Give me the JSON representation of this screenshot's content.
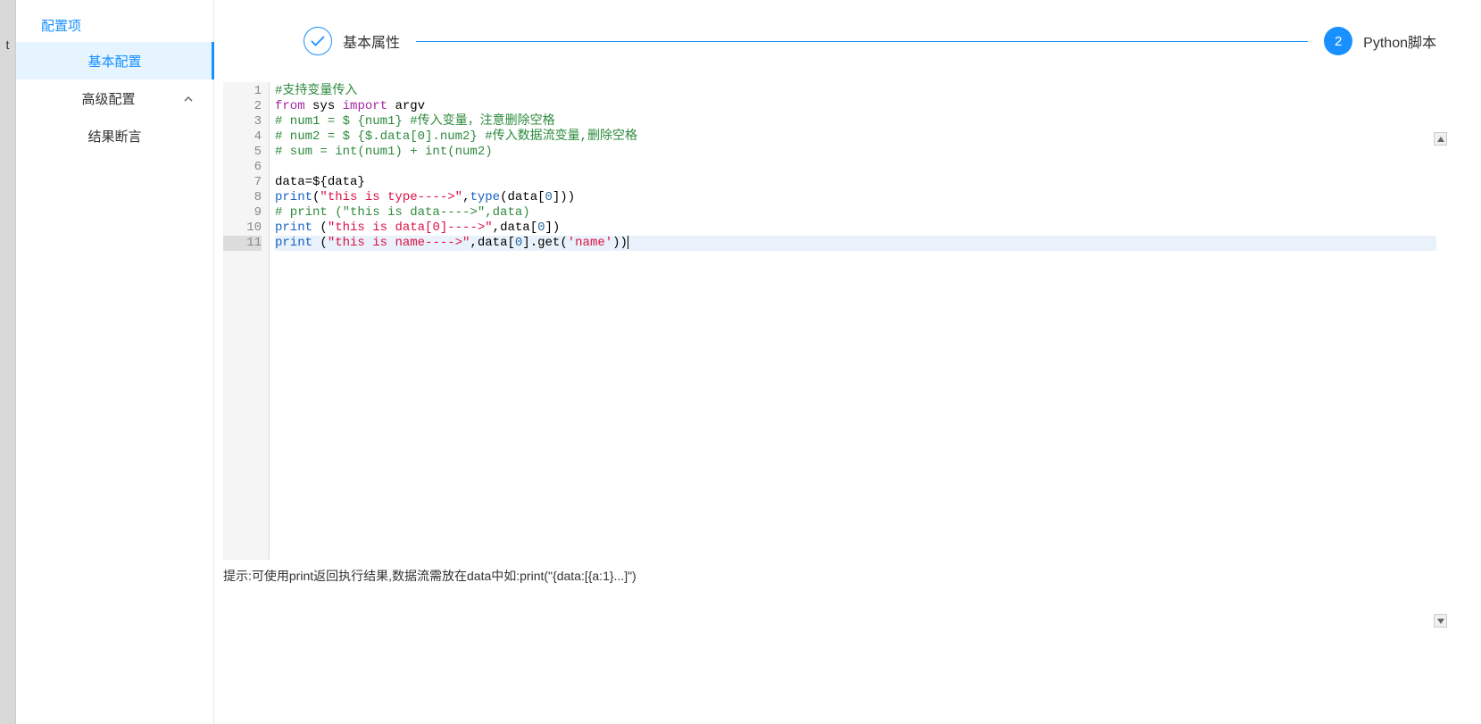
{
  "left_edge_text": "t",
  "sidebar": {
    "title": "配置项",
    "items": [
      {
        "label": "基本配置",
        "active": true
      },
      {
        "label": "高级配置",
        "expandable": true,
        "children": [
          {
            "label": "结果断言"
          }
        ]
      }
    ]
  },
  "steps": {
    "step1": {
      "label": "基本属性",
      "status": "done"
    },
    "step2": {
      "label": "Python脚本",
      "status": "current",
      "num": "2"
    }
  },
  "editor": {
    "lines": [
      {
        "n": "1",
        "html": "<span class='c-comment'>#支持变量传入</span>"
      },
      {
        "n": "2",
        "html": "<span class='c-kw'>from</span> <span class='c-def'>sys</span> <span class='c-kw'>import</span> <span class='c-def'>argv</span>"
      },
      {
        "n": "3",
        "html": "<span class='c-comment'># num1 = $ {num1} #传入变量，注意删除空格</span>"
      },
      {
        "n": "4",
        "html": "<span class='c-comment'># num2 = $ {$.data[0].num2} #传入数据流变量,删除空格</span>"
      },
      {
        "n": "5",
        "html": "<span class='c-comment'># sum = int(num1) + int(num2)</span>"
      },
      {
        "n": "6",
        "html": ""
      },
      {
        "n": "7",
        "html": "<span class='c-def'>data</span>=<span class='c-def'>${data}</span>"
      },
      {
        "n": "8",
        "html": "<span class='c-builtin'>print</span>(<span class='c-str'>\"this is type----&gt;\"</span>,<span class='c-builtin'>type</span>(<span class='c-def'>data</span>[<span class='c-num'>0</span>]))"
      },
      {
        "n": "9",
        "html": "<span class='c-comment'># print (\"this is data----&gt;\",data)</span>"
      },
      {
        "n": "10",
        "html": "<span class='c-builtin'>print</span> (<span class='c-str'>\"this is data[0]----&gt;\"</span>,<span class='c-def'>data</span>[<span class='c-num'>0</span>])"
      },
      {
        "n": "11",
        "html": "<span class='c-builtin'>print</span> (<span class='c-str'>\"this is name----&gt;\"</span>,<span class='c-def'>data</span>[<span class='c-num'>0</span>].<span class='c-def'>get</span>(<span class='c-str'>'name'</span>))<span class='cursor'></span>",
        "hl": true
      }
    ]
  },
  "hint": "提示:可使用print返回执行结果,数据流需放在data中如:print(\"{data:[{a:1}...]\")"
}
